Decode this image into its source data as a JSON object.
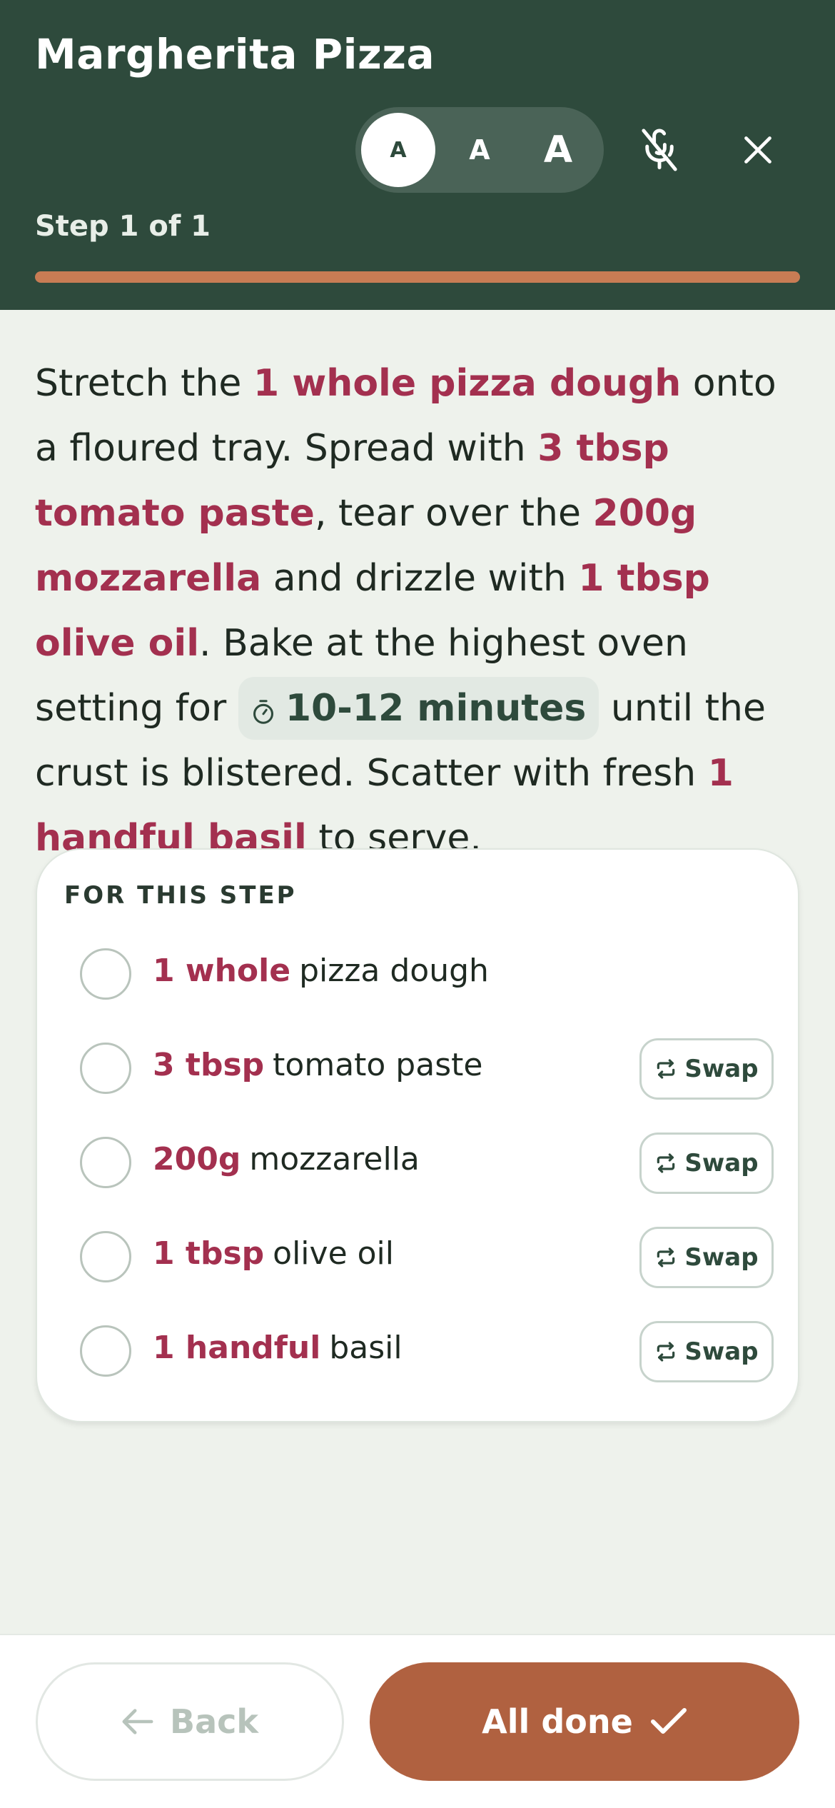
{
  "header": {
    "title": "Margherita Pizza",
    "step_label": "Step 1 of 1",
    "progress": 1.0,
    "text_size_options": [
      "A",
      "A",
      "A"
    ],
    "selected_text_size": "small"
  },
  "instruction": {
    "s1": "Stretch the ",
    "q1": "1 whole pizza dough",
    "s2": " onto a floured tray. Spread with ",
    "q2": "3 tbsp tomato paste",
    "s3": ", tear over the ",
    "q3": "200g mozzarella",
    "s4": " and drizzle with ",
    "q4": "1 tbsp olive oil",
    "s5": ". Bake at the highest oven setting for ",
    "timer": "10-12 minutes",
    "s6": " until the crust is blistered. Scatter with fresh ",
    "q5": "1 handful basil",
    "s7": " to serve."
  },
  "card": {
    "heading": "FOR THIS STEP",
    "swap_label": "Swap",
    "ingredients": [
      {
        "qty": "1 whole",
        "name": "pizza dough",
        "swap": false
      },
      {
        "qty": "3 tbsp",
        "name": "tomato paste",
        "swap": true
      },
      {
        "qty": "200g",
        "name": "mozzarella",
        "swap": true
      },
      {
        "qty": "1 tbsp",
        "name": "olive oil",
        "swap": true
      },
      {
        "qty": "1 handful",
        "name": "basil",
        "swap": true
      }
    ]
  },
  "footer": {
    "back_label": "Back",
    "done_label": "All done"
  },
  "colors": {
    "header_bg": "#2e4a3c",
    "accent": "#b06140",
    "quantity": "#a3304f",
    "progress": "#c87c54"
  },
  "icons": {
    "mic": "mic-off-icon",
    "close": "close-icon",
    "timer": "timer-icon",
    "swap": "swap-icon",
    "back": "arrow-left-icon",
    "done": "check-icon"
  }
}
